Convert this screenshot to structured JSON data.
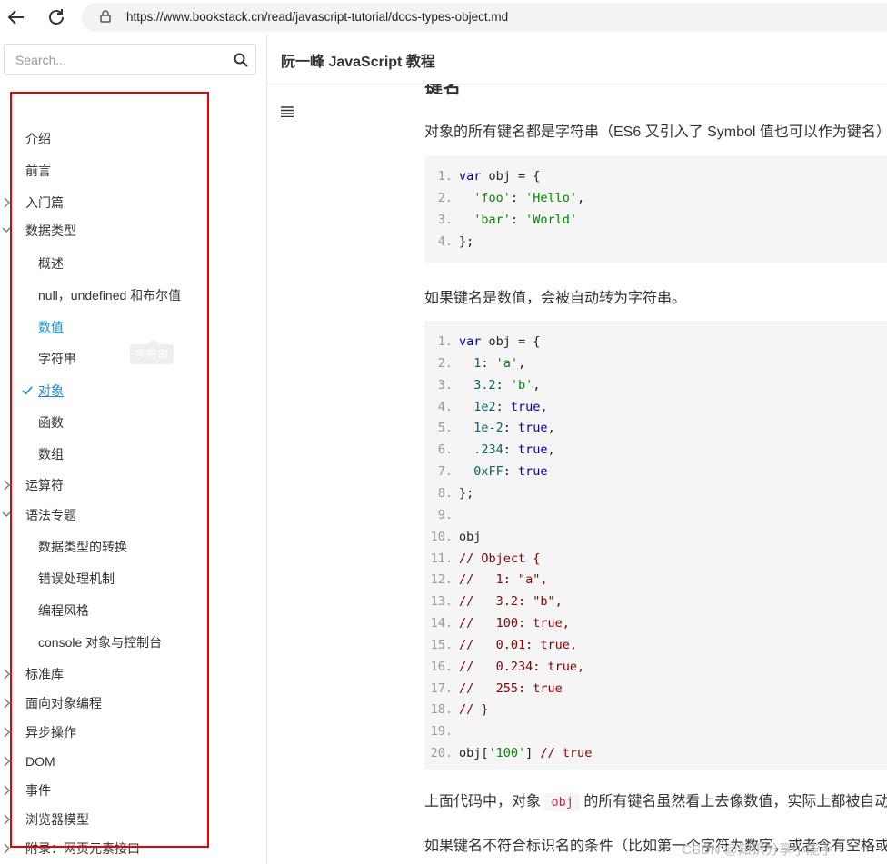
{
  "browser": {
    "url": "https://www.bookstack.cn/read/javascript-tutorial/docs-types-object.md"
  },
  "sidebar": {
    "search_placeholder": "Search...",
    "items": [
      {
        "label": "介绍",
        "level": 0,
        "expandable": false
      },
      {
        "label": "前言",
        "level": 0,
        "expandable": false
      },
      {
        "label": "入门篇",
        "level": 0,
        "expandable": true,
        "expanded": false
      },
      {
        "label": "数据类型",
        "level": 0,
        "expandable": true,
        "expanded": true
      },
      {
        "label": "概述",
        "level": 1
      },
      {
        "label": "null，undefined 和布尔值",
        "level": 1
      },
      {
        "label": "数值",
        "level": 1,
        "state": "link"
      },
      {
        "label": "字符串",
        "level": 1
      },
      {
        "label": "对象",
        "level": 1,
        "state": "current"
      },
      {
        "label": "函数",
        "level": 1
      },
      {
        "label": "数组",
        "level": 1
      },
      {
        "label": "运算符",
        "level": 0,
        "expandable": true,
        "expanded": false
      },
      {
        "label": "语法专题",
        "level": 0,
        "expandable": true,
        "expanded": true
      },
      {
        "label": "数据类型的转换",
        "level": 1
      },
      {
        "label": "错误处理机制",
        "level": 1
      },
      {
        "label": "编程风格",
        "level": 1
      },
      {
        "label": "console 对象与控制台",
        "level": 1
      },
      {
        "label": "标准库",
        "level": 0,
        "expandable": true,
        "expanded": false
      },
      {
        "label": "面向对象编程",
        "level": 0,
        "expandable": true,
        "expanded": false
      },
      {
        "label": "异步操作",
        "level": 0,
        "expandable": true,
        "expanded": false
      },
      {
        "label": "DOM",
        "level": 0,
        "expandable": true,
        "expanded": false
      },
      {
        "label": "事件",
        "level": 0,
        "expandable": true,
        "expanded": false
      },
      {
        "label": "浏览器模型",
        "level": 0,
        "expandable": true,
        "expanded": false
      },
      {
        "label": "附录：网页元素接口",
        "level": 0,
        "expandable": true,
        "expanded": false
      }
    ],
    "tooltip": "字符串"
  },
  "header": {
    "book_title": "阮一峰 JavaScript 教程"
  },
  "content": {
    "heading_fragment": "键名",
    "para1": "对象的所有键名都是字符串（ES6 又引入了 Symbol 值也可以作为键名）",
    "code1": [
      [
        "1.",
        [
          [
            "kw",
            "var"
          ],
          [
            "pl",
            " obj = {"
          ]
        ]
      ],
      [
        "2.",
        [
          [
            "pl",
            "  "
          ],
          [
            "str",
            "'foo'"
          ],
          [
            "pl",
            ": "
          ],
          [
            "str",
            "'Hello'"
          ],
          [
            "pl",
            ","
          ]
        ]
      ],
      [
        "3.",
        [
          [
            "pl",
            "  "
          ],
          [
            "str",
            "'bar'"
          ],
          [
            "pl",
            ": "
          ],
          [
            "str",
            "'World'"
          ]
        ]
      ],
      [
        "4.",
        [
          [
            "pl",
            "};"
          ]
        ]
      ]
    ],
    "para2": "如果键名是数值，会被自动转为字符串。",
    "code2": [
      [
        "1.",
        [
          [
            "kw",
            "var"
          ],
          [
            "pl",
            " obj = {"
          ]
        ]
      ],
      [
        "2.",
        [
          [
            "pl",
            "  "
          ],
          [
            "num",
            "1"
          ],
          [
            "pl",
            ": "
          ],
          [
            "str",
            "'a'"
          ],
          [
            "pl",
            ","
          ]
        ]
      ],
      [
        "3.",
        [
          [
            "pl",
            "  "
          ],
          [
            "num",
            "3.2"
          ],
          [
            "pl",
            ": "
          ],
          [
            "str",
            "'b'"
          ],
          [
            "pl",
            ","
          ]
        ]
      ],
      [
        "4.",
        [
          [
            "pl",
            "  "
          ],
          [
            "num",
            "1e2"
          ],
          [
            "pl",
            ": "
          ],
          [
            "kw",
            "true"
          ],
          [
            "pl",
            ","
          ]
        ]
      ],
      [
        "5.",
        [
          [
            "pl",
            "  "
          ],
          [
            "num",
            "1e-2"
          ],
          [
            "pl",
            ": "
          ],
          [
            "kw",
            "true"
          ],
          [
            "pl",
            ","
          ]
        ]
      ],
      [
        "6.",
        [
          [
            "pl",
            "  "
          ],
          [
            "num",
            ".234"
          ],
          [
            "pl",
            ": "
          ],
          [
            "kw",
            "true"
          ],
          [
            "pl",
            ","
          ]
        ]
      ],
      [
        "7.",
        [
          [
            "pl",
            "  "
          ],
          [
            "num",
            "0xFF"
          ],
          [
            "pl",
            ": "
          ],
          [
            "kw",
            "true"
          ]
        ]
      ],
      [
        "8.",
        [
          [
            "pl",
            "};"
          ]
        ]
      ],
      [
        "9.",
        []
      ],
      [
        "10.",
        [
          [
            "pl",
            "obj"
          ]
        ]
      ],
      [
        "11.",
        [
          [
            "cm",
            "// Object {"
          ]
        ]
      ],
      [
        "12.",
        [
          [
            "cm",
            "//   1: \"a\","
          ]
        ]
      ],
      [
        "13.",
        [
          [
            "cm",
            "//   3.2: \"b\","
          ]
        ]
      ],
      [
        "14.",
        [
          [
            "cm",
            "//   100: true,"
          ]
        ]
      ],
      [
        "15.",
        [
          [
            "cm",
            "//   0.01: true,"
          ]
        ]
      ],
      [
        "16.",
        [
          [
            "cm",
            "//   0.234: true,"
          ]
        ]
      ],
      [
        "17.",
        [
          [
            "cm",
            "//   255: true"
          ]
        ]
      ],
      [
        "18.",
        [
          [
            "cm",
            "// }"
          ]
        ]
      ],
      [
        "19.",
        []
      ],
      [
        "20.",
        [
          [
            "pl",
            "obj["
          ],
          [
            "str",
            "'100'"
          ],
          [
            "pl",
            "] "
          ],
          [
            "cm",
            "// true"
          ]
        ]
      ]
    ],
    "para3_before": "上面代码中，对象",
    "para3_code": "obj",
    "para3_after": "的所有键名虽然看上去像数值，实际上都被自动",
    "para4": "如果键名不符合标识名的条件（比如第一个字符为数字，或者含有空格或"
  },
  "watermark": "CSDN @知识分享小能手",
  "colors": {
    "link": "#1a8ed6",
    "highlight_frame": "#e00000",
    "code_bg": "#f5f5f5"
  }
}
